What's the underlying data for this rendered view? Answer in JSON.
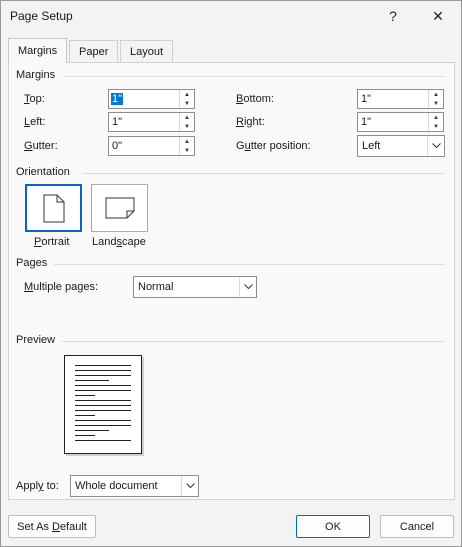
{
  "window": {
    "title": "Page Setup",
    "help_glyph": "?",
    "close_glyph": "✕"
  },
  "tabs": [
    {
      "label": "Margins",
      "active": true
    },
    {
      "label": "Paper",
      "active": false
    },
    {
      "label": "Layout",
      "active": false
    }
  ],
  "margins": {
    "group_label": "Margins",
    "top": {
      "label": "Top:",
      "value": "1\""
    },
    "bottom": {
      "label": "Bottom:",
      "value": "1\""
    },
    "left": {
      "label": "Left:",
      "value": "1\""
    },
    "right": {
      "label": "Right:",
      "value": "1\""
    },
    "gutter": {
      "label": "Gutter:",
      "value": "0\""
    },
    "gutter_position": {
      "label": "Gutter position:",
      "value": "Left"
    }
  },
  "orientation": {
    "group_label": "Orientation",
    "portrait_label": "Portrait",
    "landscape_label": "Landscape",
    "selected": "Portrait"
  },
  "pages": {
    "group_label": "Pages",
    "multiple_pages_label": "Multiple pages:",
    "multiple_pages_value": "Normal"
  },
  "preview": {
    "group_label": "Preview"
  },
  "apply_to": {
    "label": "Apply to:",
    "value": "Whole document"
  },
  "buttons": {
    "default": "Set As Default",
    "ok": "OK",
    "cancel": "Cancel"
  },
  "colors": {
    "accent": "#0078d7",
    "dialog_bg": "#f3f3f3",
    "panel_bg": "#f9f9f9"
  }
}
